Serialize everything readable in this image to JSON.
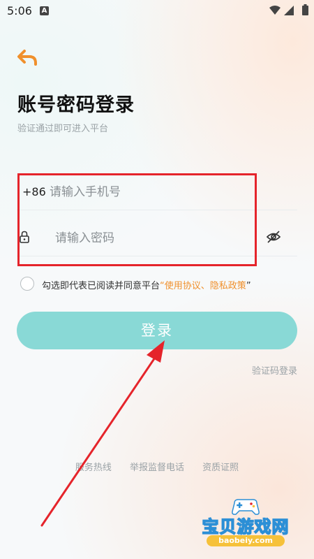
{
  "status_bar": {
    "time": "5:06",
    "notification_icon": "A"
  },
  "page": {
    "title": "账号密码登录",
    "subtitle": "验证通过即可进入平台"
  },
  "phone_field": {
    "country_code": "+86",
    "placeholder": "请输入手机号"
  },
  "password_field": {
    "placeholder": "请输入密码"
  },
  "agreement": {
    "text": "勾选即代表已阅读并同意平台",
    "open_quote": "“",
    "terms_link": "使用协议",
    "separator": "、",
    "privacy_link": "隐私政策",
    "close_quote": "”"
  },
  "login_button": {
    "label": "登录"
  },
  "sms_login_link": "验证码登录",
  "footer": {
    "service_hotline": "服务热线",
    "report_hotline": "举报监督电话",
    "qualification": "资质证照"
  },
  "watermark": {
    "title": "宝贝游戏网",
    "url": "baobeiy.com"
  },
  "colors": {
    "accent": "#f0902c",
    "button": "#89d9d6",
    "annotation_red": "#e5242b",
    "watermark_blue": "#2c8fd6"
  },
  "icons": [
    "back-arrow-icon",
    "lock-icon",
    "eye-hidden-icon",
    "wifi-icon",
    "signal-icon",
    "battery-icon",
    "gamepad-icon"
  ]
}
